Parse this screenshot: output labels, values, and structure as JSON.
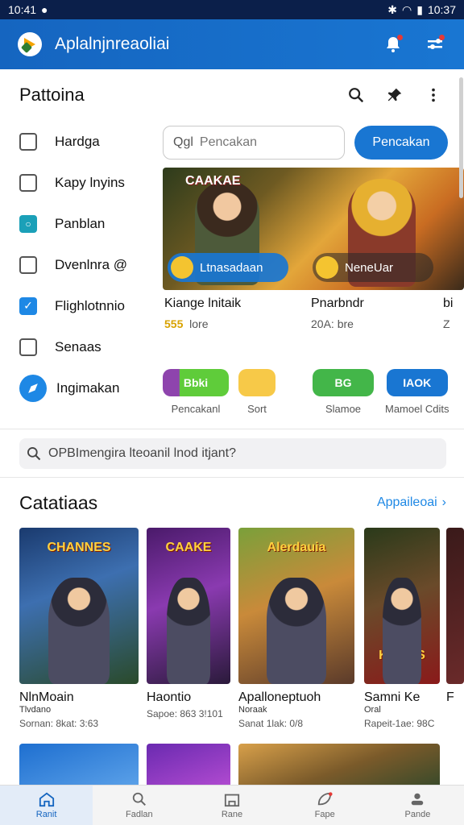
{
  "status": {
    "time": "10:41",
    "right_time": "10:37"
  },
  "app": {
    "title": "Aplalnjnreaoliai"
  },
  "page": {
    "title": "Pattoina"
  },
  "sidebar": {
    "items": [
      {
        "label": "Hardga",
        "icon": "list-icon"
      },
      {
        "label": "Kapy lnyins",
        "icon": "folder-icon"
      },
      {
        "label": "Panblan",
        "icon": "teal-square-icon"
      },
      {
        "label": "Dvenlnra @",
        "icon": "document-icon"
      },
      {
        "label": "Flighlotnnio",
        "icon": "checkbox-icon"
      },
      {
        "label": "Senaas",
        "icon": "square-icon"
      },
      {
        "label": "Ingimakan",
        "icon": "compass-icon"
      }
    ]
  },
  "search": {
    "prefix": "Qgl",
    "placeholder": "Pencakan",
    "button": "Pencakan"
  },
  "banner": {
    "title": "CAAKAE",
    "left_pill": "Ltnasadaan",
    "right_pill": "NeneUar"
  },
  "featured": [
    {
      "name": "Kiange lnitaik",
      "count": "555",
      "unit": "lore"
    },
    {
      "name": "Pnarbndr",
      "count": "",
      "unit": "20A: bre"
    },
    {
      "name": "bi",
      "count": "",
      "unit": "Z"
    }
  ],
  "chips": [
    {
      "text": "Bbki",
      "label": "Pencakanl",
      "color": "#5fcc3a"
    },
    {
      "text": "",
      "label": "Sort",
      "color": "#f7c948"
    },
    {
      "text": "BG",
      "label": "Slamoe",
      "color": "#43b649"
    },
    {
      "text": "IAOK",
      "label": "Mamoel Cdits",
      "color": "#1976d2"
    }
  ],
  "global_search": {
    "placeholder": "OPBImengira lteoanil lnod itjant?"
  },
  "catalog": {
    "title": "Catatiaas",
    "link": "Appaileoai",
    "items": [
      {
        "name": "NlnMoain",
        "sub": "Tlvdano",
        "meta": "Sornan: 8kat: 3:63",
        "art": "CHANNES"
      },
      {
        "name": "Haontio",
        "sub": "",
        "meta": "Sapoe: 863 3!101",
        "art": "CAAKE"
      },
      {
        "name": "Apalloneptuoh",
        "sub": "Noraak",
        "meta": "Sanat 1lak: 0/8",
        "art": "Alerdauia"
      },
      {
        "name": "Samni Ke",
        "sub": "Oral",
        "meta": "Rapeit-1ae: 98C",
        "art": "KAMES"
      },
      {
        "name": "F",
        "sub": "",
        "meta": "",
        "art": ""
      }
    ]
  },
  "bottom_nav": [
    {
      "label": "Ranit",
      "icon": "home-icon",
      "active": true
    },
    {
      "label": "Fadlan",
      "icon": "search-person-icon",
      "active": false
    },
    {
      "label": "Rane",
      "icon": "store-icon",
      "active": false
    },
    {
      "label": "Fape",
      "icon": "leaf-icon",
      "active": false
    },
    {
      "label": "Pande",
      "icon": "profile-icon",
      "active": false
    }
  ],
  "colors": {
    "primary": "#1976d2",
    "status_bar": "#0b1f4a",
    "accent_gold": "#d8a200"
  }
}
